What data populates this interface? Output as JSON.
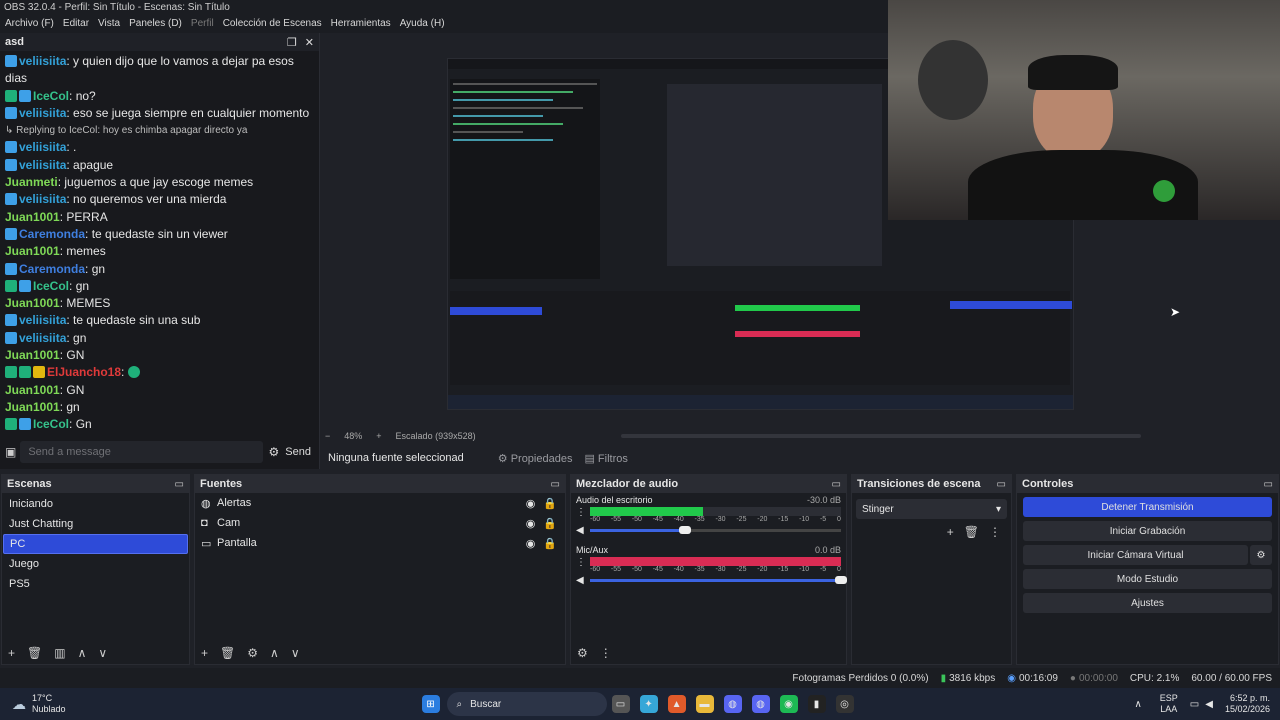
{
  "window": {
    "title": "OBS 32.0.4 - Perfil: Sin Título - Escenas: Sin Título"
  },
  "menu": [
    "Archivo (F)",
    "Editar",
    "Vista",
    "Paneles (D)",
    "Perfil",
    "Colección de Escenas",
    "Herramientas",
    "Ayuda (H)"
  ],
  "chat": {
    "dock_title": "asd",
    "messages": [
      {
        "badges": [
          "blue"
        ],
        "user": "veliisiita",
        "color": "#33a1d8",
        "text": "y quien dijo que lo vamos a dejar pa esos dias"
      },
      {
        "badges": [
          "green",
          "blue"
        ],
        "user": "IceCol",
        "color": "#35c28b",
        "text": "no?"
      },
      {
        "badges": [
          "blue"
        ],
        "user": "veliisiita",
        "color": "#33a1d8",
        "text": "eso se juega siempre en cualquier momento"
      },
      {
        "reply": "Replying to",
        "reply_user": "IceCol",
        "reply_text": "hoy es chimba apagar directo ya"
      },
      {
        "badges": [
          "blue"
        ],
        "user": "veliisiita",
        "color": "#33a1d8",
        "text": "."
      },
      {
        "badges": [
          "blue"
        ],
        "user": "veliisiita",
        "color": "#33a1d8",
        "text": "apague"
      },
      {
        "badges": [],
        "user": "Juanmeti",
        "color": "#7fd957",
        "text": "juguemos a que jay escoge memes"
      },
      {
        "badges": [
          "blue"
        ],
        "user": "veliisiita",
        "color": "#33a1d8",
        "text": "no queremos ver una mierda"
      },
      {
        "badges": [],
        "user": "Juan1001",
        "color": "#7fd957",
        "text": "PERRA"
      },
      {
        "badges": [
          "blue"
        ],
        "user": "Caremonda",
        "color": "#3f7fe0",
        "text": "te quedaste sin un viewer"
      },
      {
        "badges": [],
        "user": "Juan1001",
        "color": "#7fd957",
        "text": "memes"
      },
      {
        "badges": [
          "blue"
        ],
        "user": "Caremonda",
        "color": "#3f7fe0",
        "text": "gn"
      },
      {
        "badges": [
          "green",
          "blue"
        ],
        "user": "IceCol",
        "color": "#35c28b",
        "text": "gn"
      },
      {
        "badges": [],
        "user": "Juan1001",
        "color": "#7fd957",
        "text": "MEMES"
      },
      {
        "badges": [
          "blue"
        ],
        "user": "veliisiita",
        "color": "#33a1d8",
        "text": "te quedaste sin una sub"
      },
      {
        "badges": [
          "blue"
        ],
        "user": "veliisiita",
        "color": "#33a1d8",
        "text": "gn"
      },
      {
        "badges": [],
        "user": "Juan1001",
        "color": "#7fd957",
        "text": "GN"
      },
      {
        "badges": [
          "green",
          "green",
          "yellow"
        ],
        "user": "ElJuancho18",
        "color": "#e03a3a",
        "text": ""
      },
      {
        "badges": [],
        "user": "Juan1001",
        "color": "#7fd957",
        "text": "GN"
      },
      {
        "badges": [],
        "user": "Juan1001",
        "color": "#7fd957",
        "text": "gn"
      },
      {
        "badges": [
          "green",
          "blue"
        ],
        "user": "IceCol",
        "color": "#35c28b",
        "text": "Gn"
      }
    ],
    "input_placeholder": "Send a message",
    "send_label": "Send"
  },
  "preview": {
    "zoom": "48%",
    "scale_label": "Escalado (939x528)"
  },
  "source_toolbar": {
    "no_source": "Ninguna fuente seleccionad",
    "properties": "Propiedades",
    "filters": "Filtros"
  },
  "scenes": {
    "title": "Escenas",
    "items": [
      "Iniciando",
      "Just Chatting",
      "PC",
      "Juego",
      "PS5"
    ],
    "selected": 2
  },
  "sources": {
    "title": "Fuentes",
    "items": [
      {
        "name": "Alertas",
        "icon": "globe-icon"
      },
      {
        "name": "Cam",
        "icon": "camera-icon"
      },
      {
        "name": "Pantalla",
        "icon": "monitor-icon"
      }
    ]
  },
  "mixer": {
    "title": "Mezclador de audio",
    "channels": [
      {
        "name": "Audio del escritorio",
        "db": "-30.0 dB",
        "level": 0.45,
        "color": "#21c94b",
        "volume": 0.38
      },
      {
        "name": "Mic/Aux",
        "db": "0.0 dB",
        "level": 1.0,
        "color": "#d92c54",
        "volume": 1.0
      }
    ],
    "scale": [
      "-60",
      "-55",
      "-50",
      "-45",
      "-40",
      "-35",
      "-30",
      "-25",
      "-20",
      "-15",
      "-10",
      "-5",
      "0"
    ]
  },
  "transitions": {
    "title": "Transiciones de escena",
    "selected": "Stinger"
  },
  "controls": {
    "title": "Controles",
    "buttons": [
      "Detener Transmisión",
      "Iniciar Grabación",
      "Iniciar Cámara Virtual",
      "Modo Estudio",
      "Ajustes"
    ]
  },
  "status": {
    "dropped": "Fotogramas Perdidos 0 (0.0%)",
    "bitrate": "3816 kbps",
    "stream_time": "00:16:09",
    "rec_time": "00:00:00",
    "cpu": "CPU: 2.1%",
    "fps": "60.00 / 60.00 FPS"
  },
  "taskbar": {
    "weather_temp": "17°C",
    "weather_desc": "Nublado",
    "search": "Buscar",
    "lang": "ESP",
    "lang2": "LAA",
    "time": "6:52 p. m.",
    "date": "15/02/2026"
  }
}
